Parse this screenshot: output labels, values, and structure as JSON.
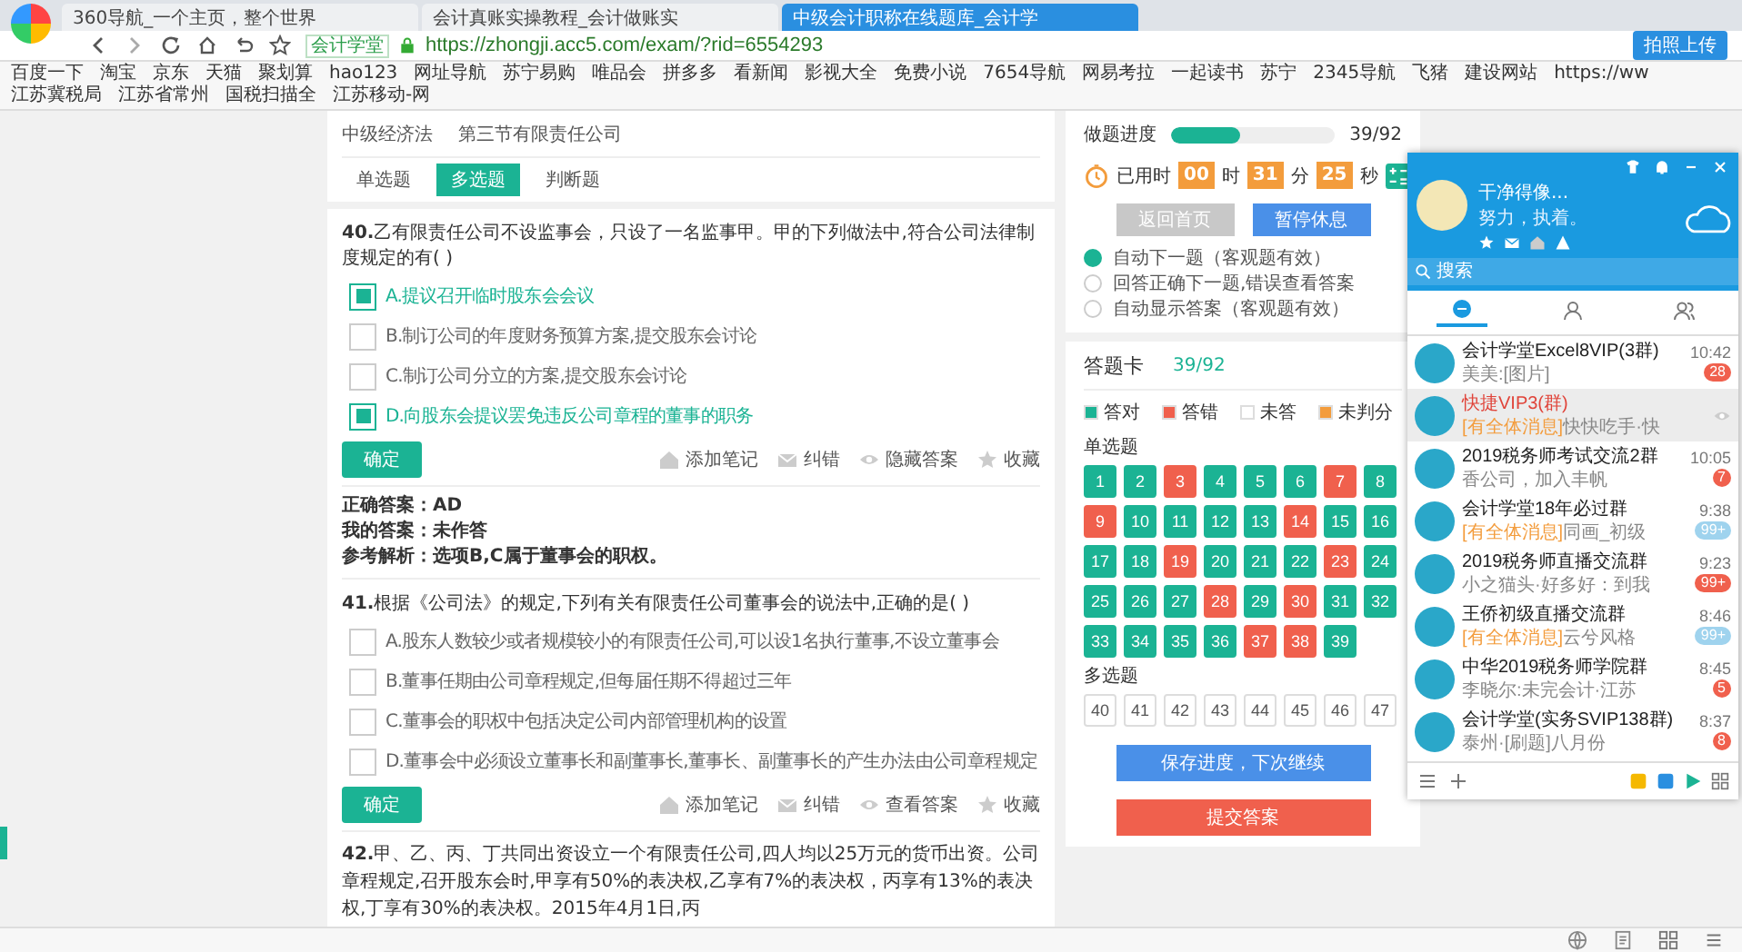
{
  "browser": {
    "tabs": [
      {
        "title": "360导航_一个主页，整个世界",
        "selected": false
      },
      {
        "title": "会计真账实操教程_会计做账实",
        "selected": false
      },
      {
        "title": "中级会计职称在线题库_会计学",
        "selected": true
      }
    ],
    "url": "https://zhongji.acc5.com/exam/?rid=6554293",
    "site_badge": "会计学堂",
    "upload_button": "拍照上传",
    "bookmarks": [
      "百度一下",
      "淘宝",
      "京东",
      "天猫",
      "聚划算",
      "hao123",
      "网址导航",
      "苏宁易购",
      "唯品会",
      "拼多多",
      "看新闻",
      "影视大全",
      "免费小说",
      "7654导航",
      "网易考拉",
      "一起读书",
      "苏宁",
      "2345导航",
      "飞猪",
      "建设网站",
      "https://ww",
      "江苏冀税局",
      "江苏省常州",
      "国税扫描全",
      "江苏移动-网"
    ]
  },
  "breadcrumb": [
    "中级经济法",
    "第三节有限责任公司"
  ],
  "question_tabs": [
    {
      "label": "单选题",
      "selected": false
    },
    {
      "label": "多选题",
      "selected": true
    },
    {
      "label": "判断题",
      "selected": false
    }
  ],
  "questions": [
    {
      "number": "40.",
      "text": "乙有限责任公司不设监事会，只设了一名监事甲。甲的下列做法中,符合公司法律制度规定的有( )",
      "options": [
        {
          "text": "A.提议召开临时股东会会议",
          "checked": true
        },
        {
          "text": "B.制订公司的年度财务预算方案,提交股东会讨论",
          "checked": false
        },
        {
          "text": "C.制订公司分立的方案,提交股东会讨论",
          "checked": false
        },
        {
          "text": "D.向股东会提议罢免违反公司章程的董事的职务",
          "checked": true
        }
      ],
      "confirm": "确定",
      "actions": [
        "添加笔记",
        "纠错",
        "隐藏答案",
        "收藏"
      ],
      "answer": [
        {
          "label": "正确答案：",
          "value": "AD"
        },
        {
          "label": "我的答案：",
          "value": "未作答"
        },
        {
          "label": "参考解析：",
          "value": "选项B,C属于董事会的职权。"
        }
      ]
    },
    {
      "number": "41.",
      "text": "根据《公司法》的规定,下列有关有限责任公司董事会的说法中,正确的是( )",
      "options": [
        {
          "text": "A.股东人数较少或者规模较小的有限责任公司,可以设1名执行董事,不设立董事会",
          "checked": false
        },
        {
          "text": "B.董事任期由公司章程规定,但每届任期不得超过三年",
          "checked": false
        },
        {
          "text": "C.董事会的职权中包括决定公司内部管理机构的设置",
          "checked": false
        },
        {
          "text": "D.董事会中必须设立董事长和副董事长,董事长、副董事长的产生办法由公司章程规定",
          "checked": false
        }
      ],
      "confirm": "确定",
      "actions": [
        "添加笔记",
        "纠错",
        "查看答案",
        "收藏"
      ]
    },
    {
      "number": "42.",
      "text": "甲、乙、丙、丁共同出资设立一个有限责任公司,四人均以25万元的货币出资。公司章程规定,召开股东会时,甲享有50%的表决权,乙享有7%的表决权，丙享有13%的表决权,丁享有30%的表决权。2015年4月1日,丙"
    }
  ],
  "progress": {
    "label": "做题进度",
    "level": 0.424,
    "reading": "39/92"
  },
  "timer": {
    "label": "已用时",
    "parts": [
      {
        "value": "00",
        "unit": "时"
      },
      {
        "value": "31",
        "unit": "分"
      },
      {
        "value": "25",
        "unit": "秒"
      }
    ]
  },
  "nav_buttons": [
    {
      "label": "返回首页",
      "disabled": true
    },
    {
      "label": "暂停休息",
      "disabled": false
    }
  ],
  "modes": [
    {
      "label": "自动下一题（客观题有效）",
      "selected": true
    },
    {
      "label": "回答正确下一题,错误查看答案",
      "selected": false
    },
    {
      "label": "自动显示答案（客观题有效）",
      "selected": false
    }
  ],
  "answer_card": {
    "title": "答题卡",
    "count": "39/92",
    "legend": [
      {
        "label": "答对",
        "color": "#1bb394"
      },
      {
        "label": "答错",
        "color": "#f0604d"
      },
      {
        "label": "未答",
        "color": "#ffffff"
      },
      {
        "label": "未判分",
        "color": "#f39c3c"
      }
    ],
    "sections": [
      {
        "title": "单选题",
        "items": [
          {
            "n": "1",
            "color": "#1bb394"
          },
          {
            "n": "2",
            "color": "#1bb394"
          },
          {
            "n": "3",
            "color": "#f0604d"
          },
          {
            "n": "4",
            "color": "#1bb394"
          },
          {
            "n": "5",
            "color": "#1bb394"
          },
          {
            "n": "6",
            "color": "#1bb394"
          },
          {
            "n": "7",
            "color": "#f0604d"
          },
          {
            "n": "8",
            "color": "#1bb394"
          },
          {
            "n": "9",
            "color": "#f0604d"
          },
          {
            "n": "10",
            "color": "#1bb394"
          },
          {
            "n": "11",
            "color": "#1bb394"
          },
          {
            "n": "12",
            "color": "#1bb394"
          },
          {
            "n": "13",
            "color": "#1bb394"
          },
          {
            "n": "14",
            "color": "#f0604d"
          },
          {
            "n": "15",
            "color": "#1bb394"
          },
          {
            "n": "16",
            "color": "#1bb394"
          },
          {
            "n": "17",
            "color": "#1bb394"
          },
          {
            "n": "18",
            "color": "#1bb394"
          },
          {
            "n": "19",
            "color": "#f0604d"
          },
          {
            "n": "20",
            "color": "#1bb394"
          },
          {
            "n": "21",
            "color": "#1bb394"
          },
          {
            "n": "22",
            "color": "#1bb394"
          },
          {
            "n": "23",
            "color": "#f0604d"
          },
          {
            "n": "24",
            "color": "#1bb394"
          },
          {
            "n": "25",
            "color": "#1bb394"
          },
          {
            "n": "26",
            "color": "#1bb394"
          },
          {
            "n": "27",
            "color": "#1bb394"
          },
          {
            "n": "28",
            "color": "#f0604d"
          },
          {
            "n": "29",
            "color": "#1bb394"
          },
          {
            "n": "30",
            "color": "#f0604d"
          },
          {
            "n": "31",
            "color": "#1bb394"
          },
          {
            "n": "32",
            "color": "#1bb394"
          },
          {
            "n": "33",
            "color": "#1bb394"
          },
          {
            "n": "34",
            "color": "#1bb394"
          },
          {
            "n": "35",
            "color": "#1bb394"
          },
          {
            "n": "36",
            "color": "#1bb394"
          },
          {
            "n": "37",
            "color": "#f0604d"
          },
          {
            "n": "38",
            "color": "#f0604d"
          },
          {
            "n": "39",
            "color": "#1bb394"
          }
        ]
      },
      {
        "title": "多选题",
        "items": [
          {
            "n": "40",
            "color": "#ffffff"
          },
          {
            "n": "41",
            "color": "#ffffff"
          },
          {
            "n": "42",
            "color": "#ffffff"
          },
          {
            "n": "43",
            "color": "#ffffff"
          },
          {
            "n": "44",
            "color": "#ffffff"
          },
          {
            "n": "45",
            "color": "#ffffff"
          },
          {
            "n": "46",
            "color": "#ffffff"
          },
          {
            "n": "47",
            "color": "#ffffff"
          }
        ]
      }
    ],
    "save_button": "保存进度，下次继续",
    "submit_button": "提交答案"
  },
  "chat": {
    "user": "干净得像...",
    "signature": "努力，执着。",
    "search_placeholder": "搜索",
    "items": [
      {
        "name": "会计学堂Excel8VIP(3群)",
        "preview": "美美:[图片]",
        "time": "10:42",
        "badge": "28",
        "muted": false,
        "selected": false
      },
      {
        "name": "快捷VIP3(群)",
        "tag": "[有全体消息]",
        "preview": "快快吃手·快",
        "selected": true
      },
      {
        "name": "2019税务师考试交流2群",
        "preview": "香公司，加入丰帆",
        "time": "10:05",
        "badge": "7",
        "muted": false,
        "selected": false
      },
      {
        "name": "会计学堂18年必过群",
        "tag": "[有全体消息]",
        "preview": "同画_初级",
        "time": "9:38",
        "badge": "99+",
        "muted": true,
        "selected": false
      },
      {
        "name": "2019税务师直播交流群",
        "preview": "小之猫头·好多好：到我",
        "time": "9:23",
        "badge": "99+",
        "muted": false,
        "selected": false
      },
      {
        "name": "王侨初级直播交流群",
        "tag": "[有全体消息]",
        "preview": "云兮风格",
        "time": "8:46",
        "badge": "99+",
        "muted": true,
        "selected": false
      },
      {
        "name": "中华2019税务师学院群",
        "preview": "李晓尔:未完会计·江苏",
        "time": "8:45",
        "badge": "5",
        "muted": false,
        "selected": false
      },
      {
        "name": "会计学堂(实务SVIP138群)",
        "preview": "泰州·[刷题]八月份",
        "time": "8:37",
        "badge": "8",
        "muted": false,
        "selected": false
      }
    ]
  }
}
